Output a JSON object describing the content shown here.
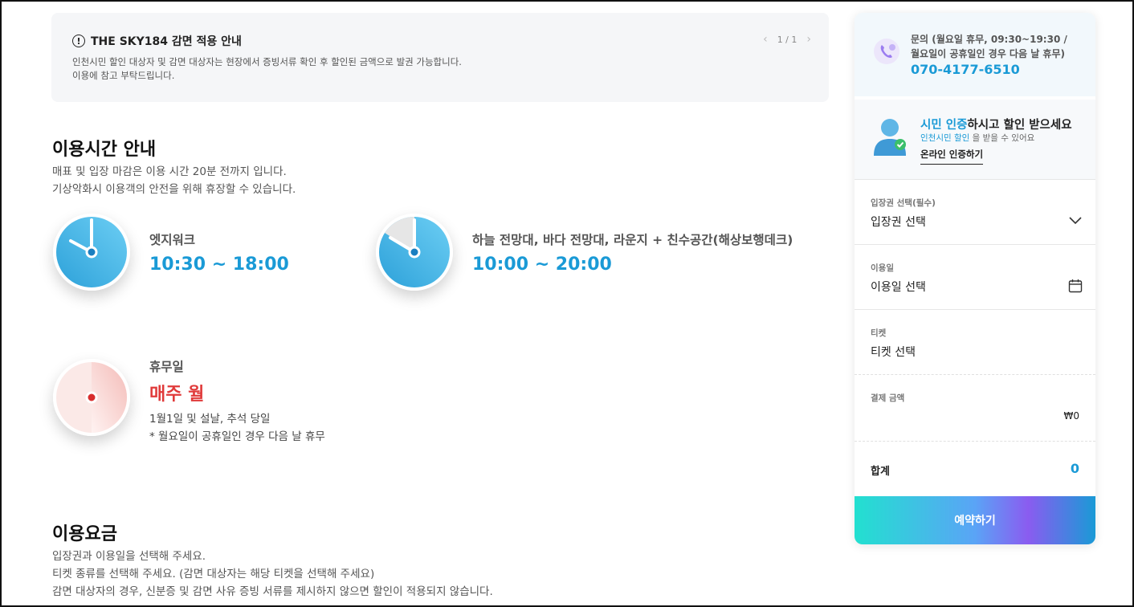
{
  "notice": {
    "title": "THE SKY184 감면 적용 안내",
    "text_line1": "인천시민 할인 대상자 및 감면 대상자는 현장에서 증빙서류 확인 후 할인된 금액으로 발권 가능합니다.",
    "text_line2": "이용에 참고 부탁드립니다.",
    "pager": "1 / 1"
  },
  "hours": {
    "title": "이용시간 안내",
    "desc1": "매표 및 입장 마감은 이용 시간 20분 전까지 입니다.",
    "desc2": "기상악화시 이용객의 안전을 위해 휴장할 수 있습니다.",
    "items": [
      {
        "label": "엣지워크",
        "time": "10:30 ~ 18:00"
      },
      {
        "label": "하늘 전망대, 바다 전망대, 라운지 + 친수공간(해상보행데크)",
        "time": "10:00 ~ 20:00"
      }
    ],
    "closed": {
      "label": "휴무일",
      "value": "매주 월",
      "sub1": "1월1일 및 설날, 추석 당일",
      "sub2": "* 월요일이 공휴일인 경우 다음 날 휴무"
    }
  },
  "fees": {
    "title": "이용요금",
    "desc1": "입장권과 이용일을 선택해 주세요.",
    "desc2": "티켓 종류를 선택해 주세요. (감면 대상자는 해당 티켓을 선택해 주세요)",
    "desc3": "감면 대상자의 경우, 신분증 및 감면 사유 증빙 서류를 제시하지 않으면 할인이 적용되지 않습니다."
  },
  "sidebar": {
    "contact_line1": "문의 (월요일 휴무, 09:30~19:30 /",
    "contact_line2": "월요일이 공휴일인 경우 다음 날 휴무)",
    "contact_phone": "070-4177-6510",
    "cert_title_hl": "시민 인증",
    "cert_title_rest": "하시고 할인 받으세요",
    "cert_sub_hl": "인천시민 할인",
    "cert_sub_rest": " 을 받을 수 있어요",
    "cert_link": "온라인 인증하기",
    "ticket_label": "입장권 선택(필수)",
    "ticket_value": "입장권 선택",
    "date_label": "이용일",
    "date_value": "이용일 선택",
    "kind_label": "티켓",
    "kind_value": "티켓 선택",
    "pay_label": "결제 금액",
    "pay_value": "₩0",
    "total_label": "합계",
    "total_value": "0",
    "reserve": "예약하기"
  },
  "colors": {
    "accent": "#1a9ad6",
    "closed": "#e03a3a"
  }
}
